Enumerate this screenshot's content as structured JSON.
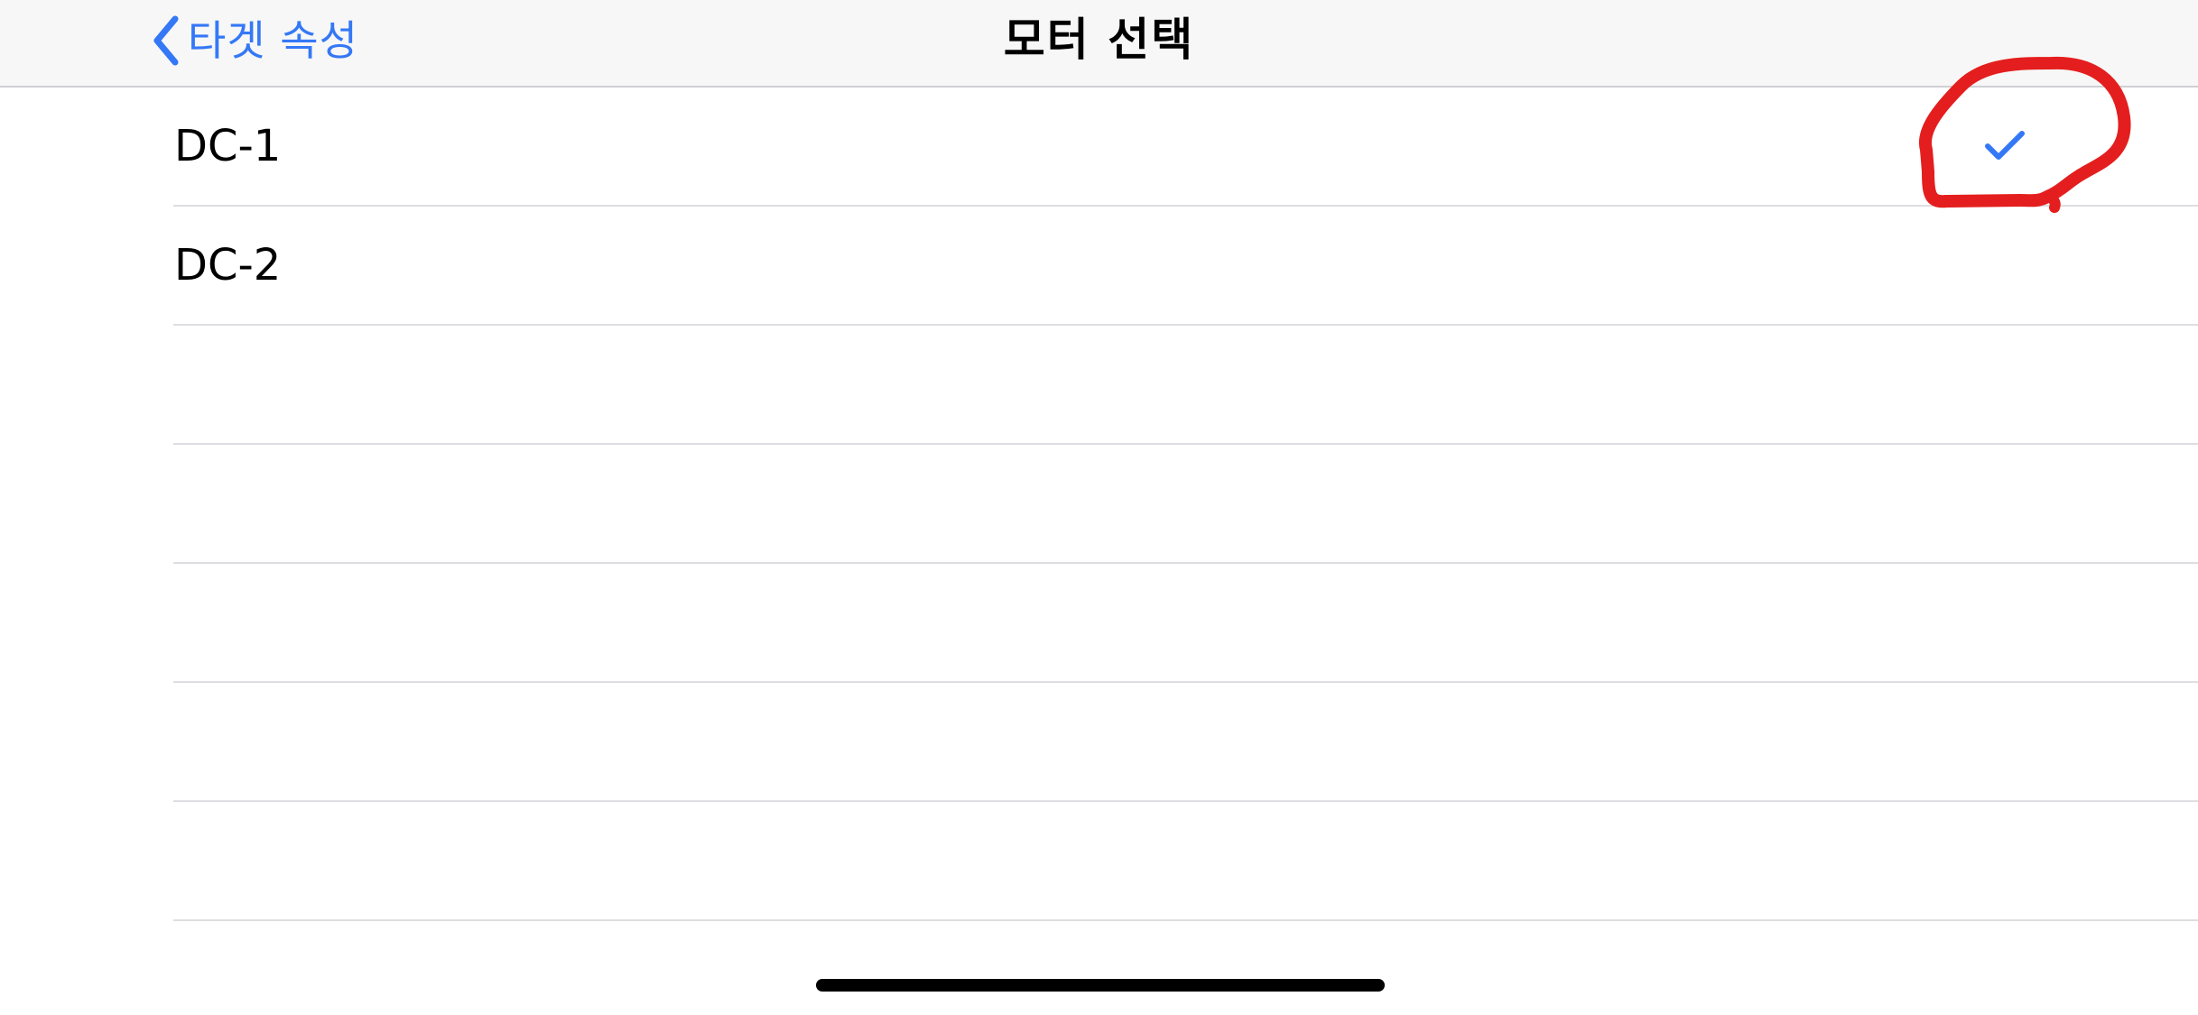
{
  "nav": {
    "back_label": "타겟 속성",
    "title": "모터 선택"
  },
  "list": {
    "items": [
      {
        "label": "DC-1",
        "selected": true
      },
      {
        "label": "DC-2",
        "selected": false
      }
    ],
    "empty_rows": 5
  },
  "colors": {
    "accent": "#3478f6",
    "annotation": "#e41e1e",
    "navbar_bg": "#f7f7f7",
    "separator": "#dedee2"
  },
  "icons": {
    "back": "chevron-left-icon",
    "selected": "checkmark-icon"
  }
}
